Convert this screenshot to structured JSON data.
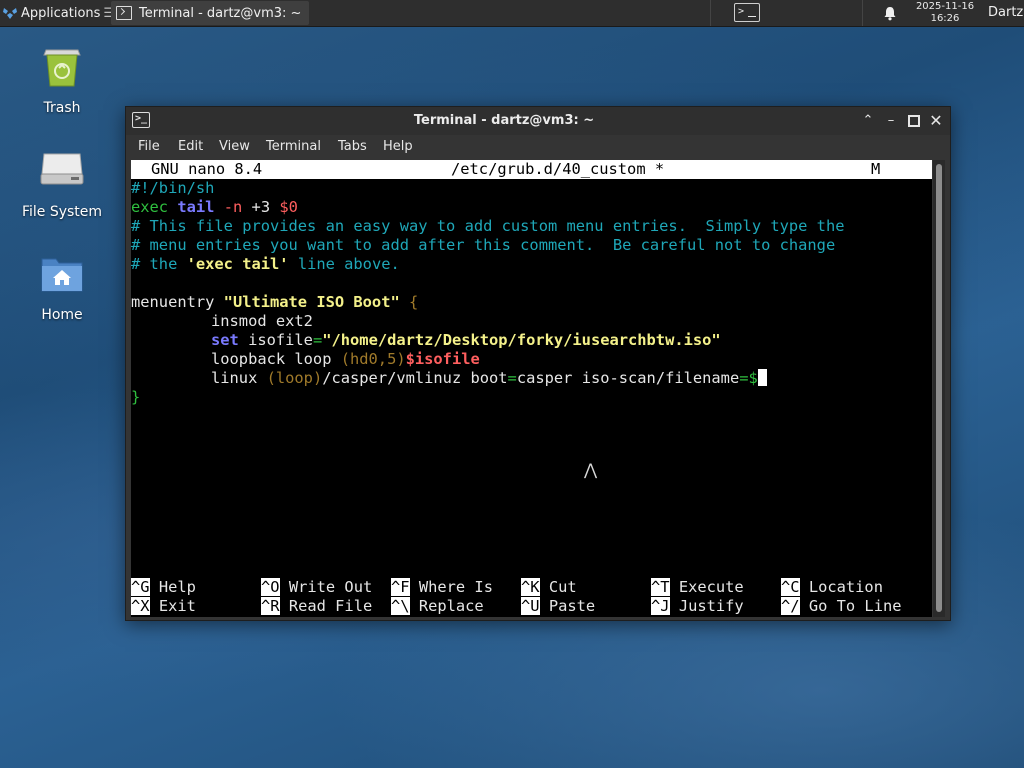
{
  "panel": {
    "applications_label": "Applications",
    "task_title": "Terminal - dartz@vm3: ~",
    "clock_date": "2025-11-16",
    "clock_time": "16:26",
    "user": "Dartz"
  },
  "desktop": {
    "icons": [
      {
        "label": "Trash",
        "icon": "trash-icon"
      },
      {
        "label": "File System",
        "icon": "drive-icon"
      },
      {
        "label": "Home",
        "icon": "home-folder-icon"
      }
    ]
  },
  "window": {
    "title": "Terminal - dartz@vm3: ~",
    "menu": [
      "File",
      "Edit",
      "View",
      "Terminal",
      "Tabs",
      "Help"
    ]
  },
  "nano": {
    "version": "GNU nano 8.4",
    "filename": "/etc/grub.d/40_custom *",
    "modified_flag": "M",
    "lines": {
      "shebang": "#!/bin/sh",
      "exec_kw": "exec",
      "tail_kw": "tail",
      "tail_flag": "-n",
      "tail_arg": "+3",
      "tail_var": "$0",
      "comment1": "# This file provides an easy way to add custom menu entries.  Simply type the",
      "comment2": "# menu entries you want to add after this comment.  Be careful not to change",
      "comment3_a": "# the ",
      "comment3_b": "'exec tail'",
      "comment3_c": " line above.",
      "menuentry_kw": "menuentry ",
      "menuentry_name": "\"Ultimate ISO Boot\"",
      "brace_open": " {",
      "insmod": "insmod ext2",
      "set_kw": "set",
      "isofile_name": " isofile",
      "eq": "=",
      "isofile_value": "\"/home/dartz/Desktop/forky/iusearchbtw.iso\"",
      "loopback_a": "loopback loop ",
      "loopback_paren": "(hd0,5)",
      "loopback_var": "$isofile",
      "linux_a": "linux ",
      "linux_paren": "(loop)",
      "linux_b": "/casper/vmlinuz boot",
      "linux_eq1": "=",
      "linux_c": "casper iso-scan/filename",
      "linux_eq2": "=",
      "linux_trunc": "$",
      "brace_close": "}"
    },
    "shortcuts": [
      {
        "key": "^G",
        "label": "Help"
      },
      {
        "key": "^O",
        "label": "Write Out"
      },
      {
        "key": "^F",
        "label": "Where Is"
      },
      {
        "key": "^K",
        "label": "Cut"
      },
      {
        "key": "^T",
        "label": "Execute"
      },
      {
        "key": "^C",
        "label": "Location"
      },
      {
        "key": "^X",
        "label": "Exit"
      },
      {
        "key": "^R",
        "label": "Read File"
      },
      {
        "key": "^\\",
        "label": "Replace"
      },
      {
        "key": "^U",
        "label": "Paste"
      },
      {
        "key": "^J",
        "label": "Justify"
      },
      {
        "key": "^/",
        "label": "Go To Line"
      }
    ]
  }
}
